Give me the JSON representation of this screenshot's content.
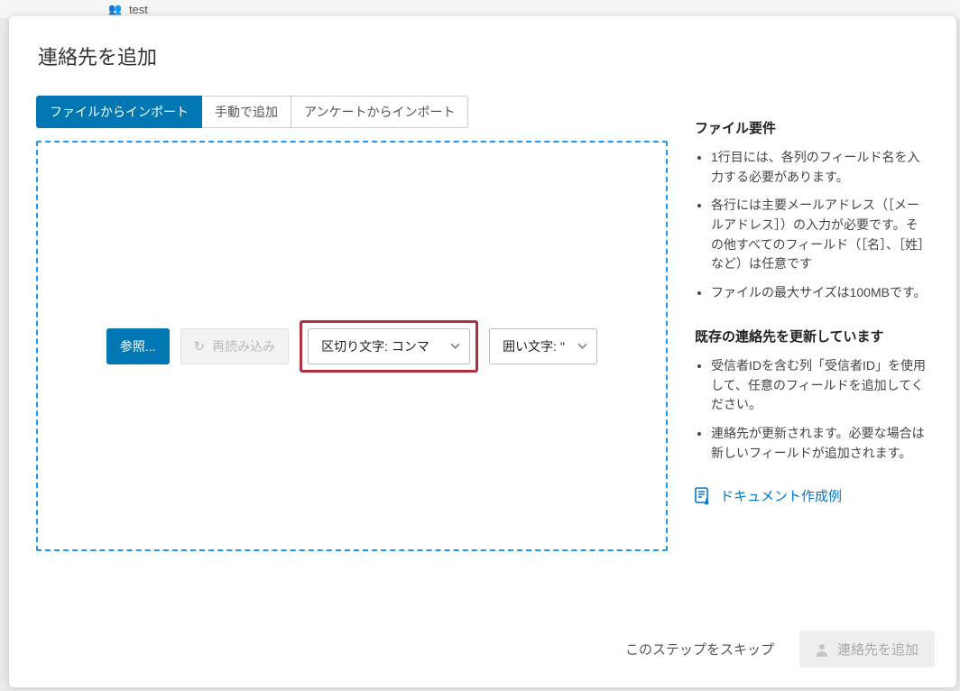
{
  "background": {
    "remnant_text": "test"
  },
  "modal": {
    "title": "連絡先を追加",
    "tabs": [
      {
        "label": "ファイルからインポート",
        "active": true
      },
      {
        "label": "手動で追加",
        "active": false
      },
      {
        "label": "アンケートからインポート",
        "active": false
      }
    ],
    "dropzone": {
      "browse_label": "参照...",
      "reload_label": "再読み込み",
      "delimiter_select": "区切り文字: コンマ",
      "enclosure_select": "囲い文字: \""
    },
    "sidebar": {
      "req_heading": "ファイル要件",
      "req_items": [
        "1行目には、各列のフィールド名を入力する必要があります。",
        "各行には主要メールアドレス（［メールアドレス］）の入力が必要です。その他すべてのフィールド（［名］、［姓］など）は任意です",
        "ファイルの最大サイズは100MBです。"
      ],
      "update_heading": "既存の連絡先を更新しています",
      "update_items": [
        "受信者IDを含む列「受信者ID」を使用して、任意のフィールドを追加してください。",
        "連絡先が更新されます。必要な場合は新しいフィールドが追加されます。"
      ],
      "doc_link_label": "ドキュメント作成例"
    },
    "footer": {
      "skip_label": "このステップをスキップ",
      "submit_label": "連絡先を追加"
    }
  }
}
